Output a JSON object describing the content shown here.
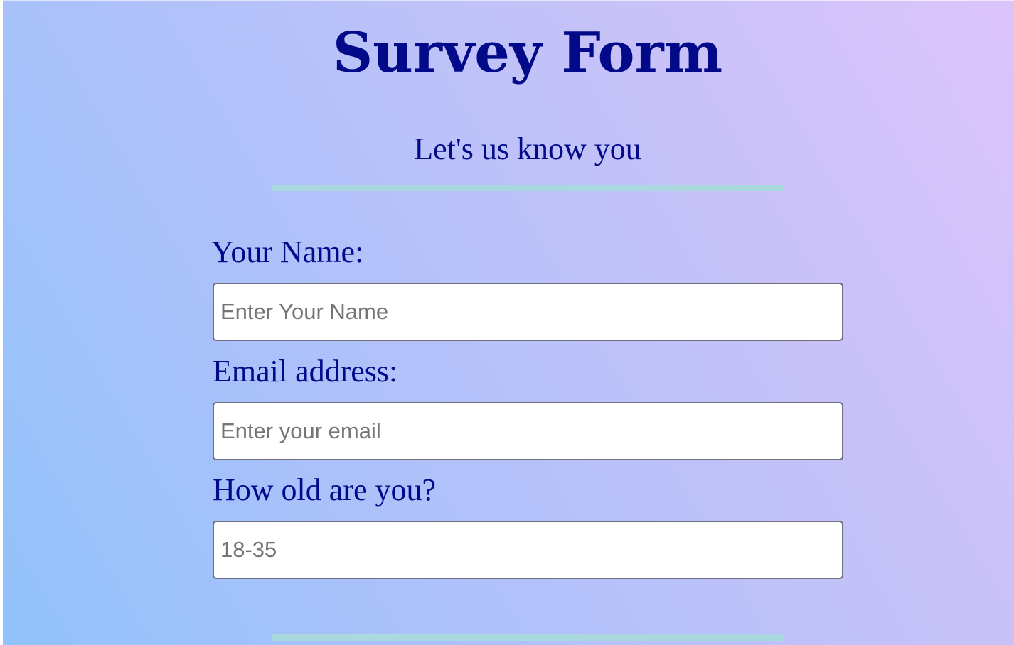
{
  "header": {
    "title": "Survey Form",
    "subtitle": "Let's us know you"
  },
  "form": {
    "name": {
      "label": "Your Name:",
      "placeholder": "Enter Your Name",
      "value": ""
    },
    "email": {
      "label": "Email address:",
      "placeholder": "Enter your email",
      "value": ""
    },
    "age": {
      "label": "How old are you?",
      "placeholder": "18-35",
      "value": ""
    }
  },
  "colors": {
    "text": "#020a8a",
    "divider": "#a9d8de",
    "gradient_start": "#92c2fa",
    "gradient_end": "#dcc4fb"
  }
}
